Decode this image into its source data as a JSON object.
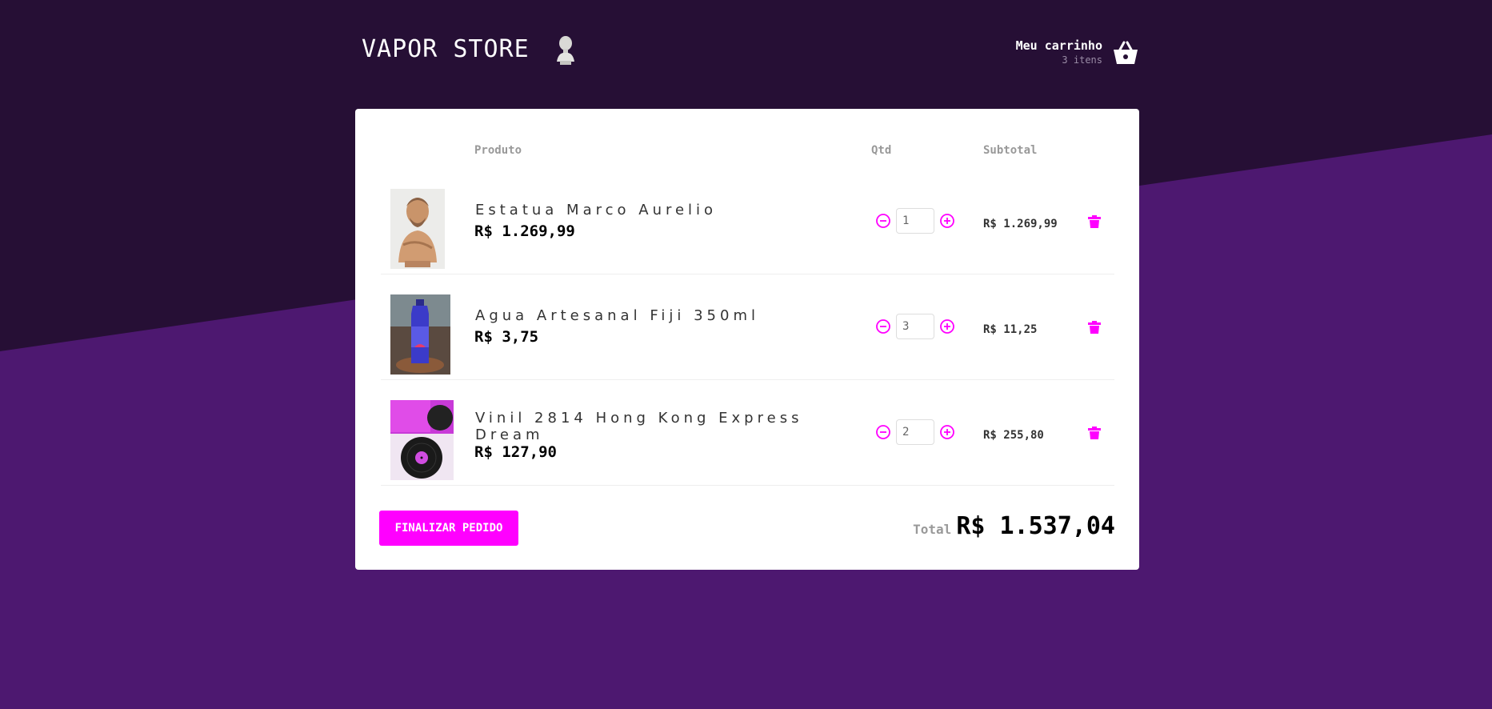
{
  "store": {
    "name": "VAPOR STORE",
    "logo_icon": "greek-bust-icon"
  },
  "cart_link": {
    "title": "Meu carrinho",
    "count": "3 itens",
    "icon": "basket-icon"
  },
  "table": {
    "col_product": "Produto",
    "col_qty": "Qtd",
    "col_subtotal": "Subtotal"
  },
  "items": [
    {
      "name": "Estatua Marco Aurelio",
      "price": "R$ 1.269,99",
      "qty": "1",
      "subtotal": "R$ 1.269,99",
      "image": "marcus-aurelius-bust"
    },
    {
      "name": "Agua Artesanal Fiji 350ml",
      "price": "R$ 3,75",
      "qty": "3",
      "subtotal": "R$ 11,25",
      "image": "fiji-water-bottle"
    },
    {
      "name": "Vinil 2814 Hong Kong Express Dream",
      "price": "R$ 127,90",
      "qty": "2",
      "subtotal": "R$ 255,80",
      "image": "vinyl-record"
    }
  ],
  "footer": {
    "finalize_label": "FINALIZAR PEDIDO",
    "total_label": "Total",
    "total_value": "R$ 1.537,04"
  },
  "colors": {
    "accent": "#ff00ff",
    "bg_dark": "#260f35",
    "bg_purple": "#4d1870",
    "card": "#ffffff"
  }
}
